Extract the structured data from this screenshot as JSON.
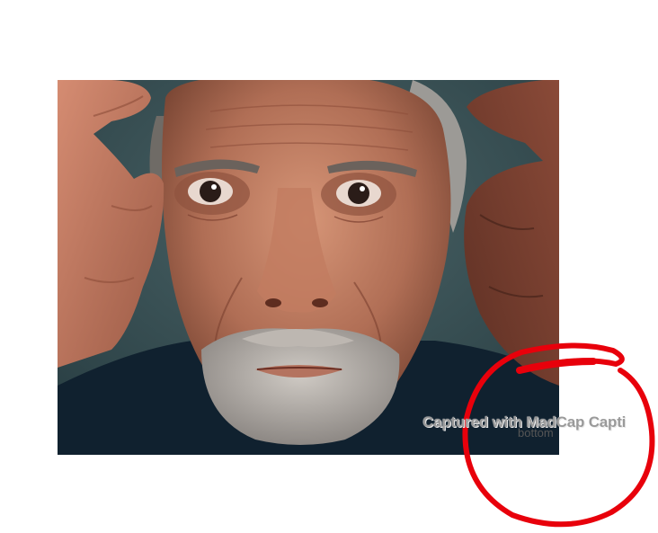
{
  "photo": {
    "subject": "portrait-photo",
    "background_color": "#2f4a4f"
  },
  "annotation": {
    "shape": "circle",
    "color": "#e8000b"
  },
  "watermark": {
    "text": "Captured with MadCap Capti"
  },
  "callout": {
    "label": "bottom"
  }
}
